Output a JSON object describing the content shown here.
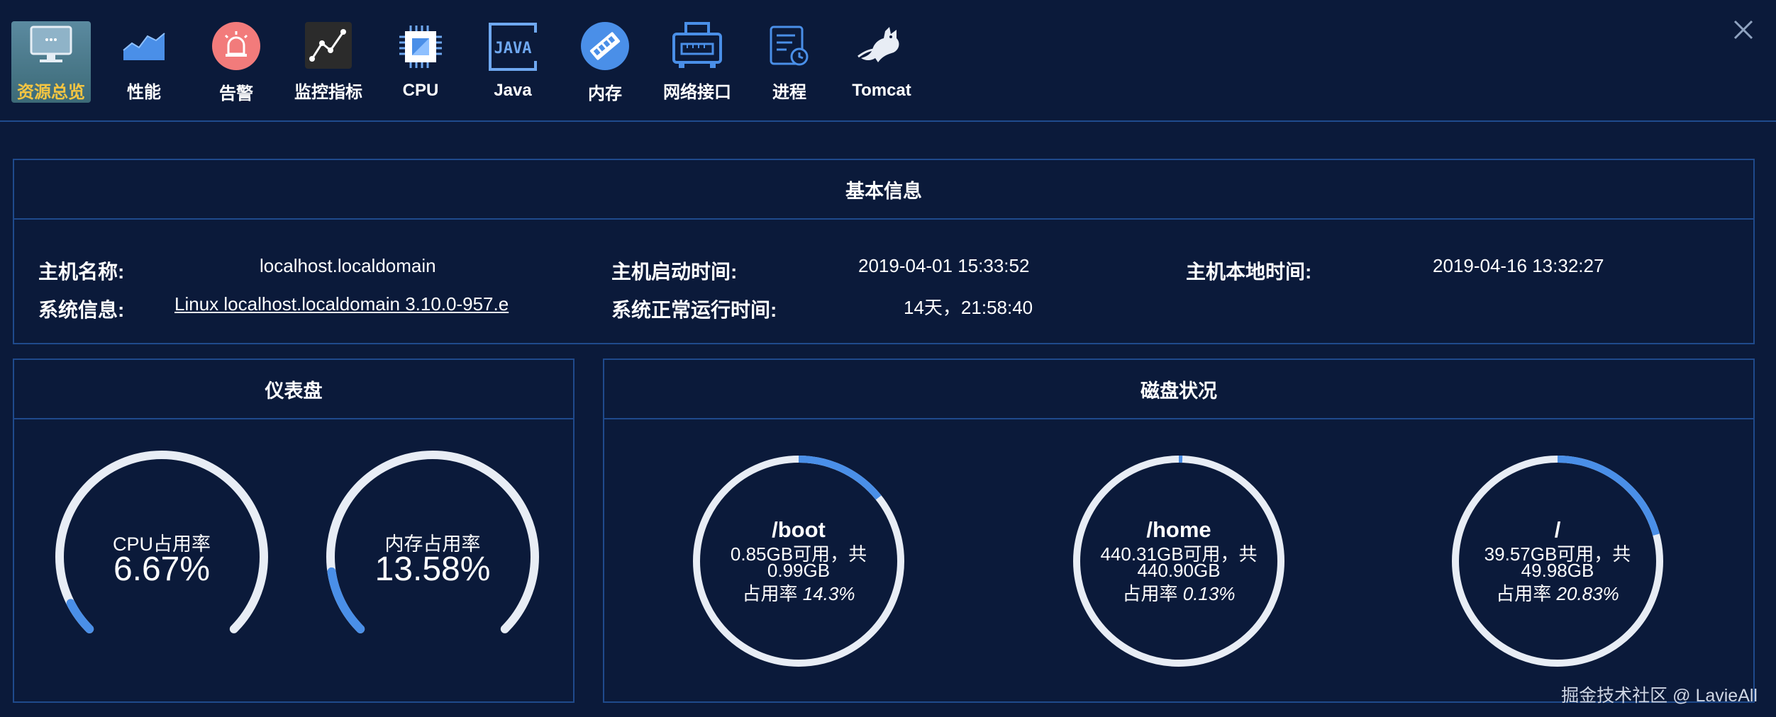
{
  "nav": {
    "items": [
      {
        "label": "资源总览",
        "icon": "monitor-icon"
      },
      {
        "label": "性能",
        "icon": "area-chart-icon"
      },
      {
        "label": "告警",
        "icon": "alarm-icon"
      },
      {
        "label": "监控指标",
        "icon": "line-chart-icon"
      },
      {
        "label": "CPU",
        "icon": "cpu-icon"
      },
      {
        "label": "Java",
        "icon": "java-icon"
      },
      {
        "label": "内存",
        "icon": "memory-icon"
      },
      {
        "label": "网络接口",
        "icon": "network-icon"
      },
      {
        "label": "进程",
        "icon": "process-icon"
      },
      {
        "label": "Tomcat",
        "icon": "tomcat-icon"
      }
    ],
    "active": "资源总览"
  },
  "basic": {
    "title": "基本信息",
    "host_label": "主机名称:",
    "host_value": "localhost.localdomain",
    "sys_label": "系统信息:",
    "sys_value": "Linux localhost.localdomain 3.10.0-957.e",
    "boot_label": "主机启动时间:",
    "boot_value": "2019-04-01 15:33:52",
    "uptime_label": "系统正常运行时间:",
    "uptime_value": "14天，21:58:40",
    "local_label": "主机本地时间:",
    "local_value": "2019-04-16 13:32:27"
  },
  "dashboard": {
    "title": "仪表盘",
    "cpu": {
      "label": "CPU占用率",
      "value_text": "6.67%",
      "value": 6.67
    },
    "mem": {
      "label": "内存占用率",
      "value_text": "13.58%",
      "value": 13.58
    }
  },
  "disk": {
    "title": "磁盘状况",
    "items": [
      {
        "mount": "/boot",
        "avail": "0.85GB可用，共",
        "total": "0.99GB",
        "usage_label": "占用率",
        "usage_text": "14.3%",
        "usage": 14.3
      },
      {
        "mount": "/home",
        "avail": "440.31GB可用，共",
        "total": "440.90GB",
        "usage_label": "占用率",
        "usage_text": "0.13%",
        "usage": 0.13
      },
      {
        "mount": "/",
        "avail": "39.57GB可用，共",
        "total": "49.98GB",
        "usage_label": "占用率",
        "usage_text": "20.83%",
        "usage": 20.83
      }
    ]
  },
  "watermark": "掘金技术社区 @ LavieAll",
  "colors": {
    "accent": "#4a8fe8",
    "track": "#e8edf5",
    "background": "#0b1a3a",
    "border": "#1f4a8c",
    "active_label": "#f4c542"
  }
}
